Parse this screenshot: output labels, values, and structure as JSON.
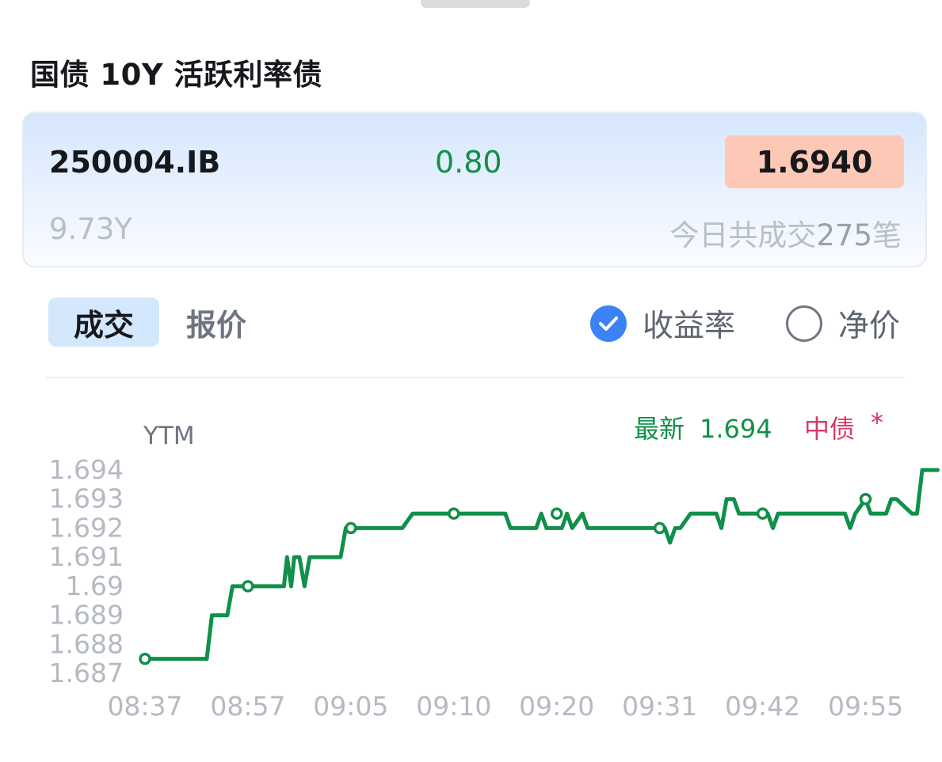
{
  "header": {
    "title": "国债 10Y 活跃利率债"
  },
  "bond": {
    "code": "250004.IB",
    "change": "0.80",
    "yield": "1.6940",
    "tenor": "9.73Y",
    "trades_prefix": "今日共成交",
    "trades_count": "275",
    "trades_suffix": "笔"
  },
  "tabs": [
    {
      "label": "成交",
      "active": true
    },
    {
      "label": "报价",
      "active": false
    }
  ],
  "price_mode": {
    "ytm_label": "收益率",
    "net_label": "净价",
    "selected": "收益率"
  },
  "colors": {
    "up_green": "#10904a",
    "accent_blue": "#3b82f6",
    "yield_badge_bg": "#fec8b7",
    "chinabond_red": "#d73a63"
  },
  "chart_data": {
    "type": "line",
    "ylabel": "YTM",
    "ylim": [
      1.687,
      1.694
    ],
    "y_ticks": [
      "1.694",
      "1.693",
      "1.692",
      "1.691",
      "1.69",
      "1.689",
      "1.688",
      "1.687"
    ],
    "x_ticks": [
      "08:37",
      "08:57",
      "09:05",
      "09:10",
      "09:20",
      "09:31",
      "09:42",
      "09:55"
    ],
    "legend": {
      "latest_label": "最新",
      "latest_value": "1.694",
      "chinabond_label": "中债",
      "chinabond_marker": "*"
    },
    "series": [
      {
        "x": [
          0,
          0.6,
          0.65,
          0.8,
          0.85,
          1.0,
          1.05,
          1.35,
          1.38,
          1.42,
          1.45,
          1.5,
          1.55,
          1.6,
          1.63,
          1.9,
          1.95,
          2.0,
          2.15,
          2.2,
          2.5,
          2.6,
          3.0,
          3.2,
          3.5,
          3.55,
          3.8,
          3.85,
          3.9,
          3.95,
          4.05,
          4.1,
          4.15,
          4.25,
          4.3,
          4.35,
          4.5,
          5.0,
          5.05,
          5.1,
          5.15,
          5.2,
          5.3,
          5.35,
          5.55,
          5.6,
          5.65,
          5.72,
          5.77,
          5.85,
          6.0,
          6.05,
          6.1,
          6.15,
          6.25,
          6.3,
          6.5,
          6.8,
          6.85,
          6.9,
          7.0,
          7.05,
          7.2,
          7.25,
          7.3,
          7.45,
          7.5,
          7.55,
          7.7
        ],
        "y": [
          1.6875,
          1.6875,
          1.689,
          1.689,
          1.69,
          1.69,
          1.69,
          1.69,
          1.691,
          1.69,
          1.691,
          1.691,
          1.69,
          1.691,
          1.691,
          1.691,
          1.692,
          1.692,
          1.692,
          1.692,
          1.692,
          1.6925,
          1.6925,
          1.6925,
          1.6925,
          1.692,
          1.692,
          1.6925,
          1.692,
          1.692,
          1.692,
          1.6925,
          1.692,
          1.6925,
          1.692,
          1.692,
          1.692,
          1.692,
          1.692,
          1.6915,
          1.692,
          1.692,
          1.6925,
          1.6925,
          1.6925,
          1.692,
          1.693,
          1.693,
          1.6925,
          1.6925,
          1.6925,
          1.6925,
          1.692,
          1.6925,
          1.6925,
          1.6925,
          1.6925,
          1.6925,
          1.692,
          1.6925,
          1.693,
          1.6925,
          1.6925,
          1.693,
          1.693,
          1.6925,
          1.6925,
          1.694,
          1.694
        ],
        "markers": [
          {
            "x": 0,
            "y": 1.6875
          },
          {
            "x": 1.0,
            "y": 1.69
          },
          {
            "x": 2.0,
            "y": 1.692
          },
          {
            "x": 3.0,
            "y": 1.6925
          },
          {
            "x": 4.0,
            "y": 1.6925
          },
          {
            "x": 5.0,
            "y": 1.692
          },
          {
            "x": 6.0,
            "y": 1.6925
          },
          {
            "x": 7.0,
            "y": 1.693
          }
        ]
      }
    ]
  }
}
